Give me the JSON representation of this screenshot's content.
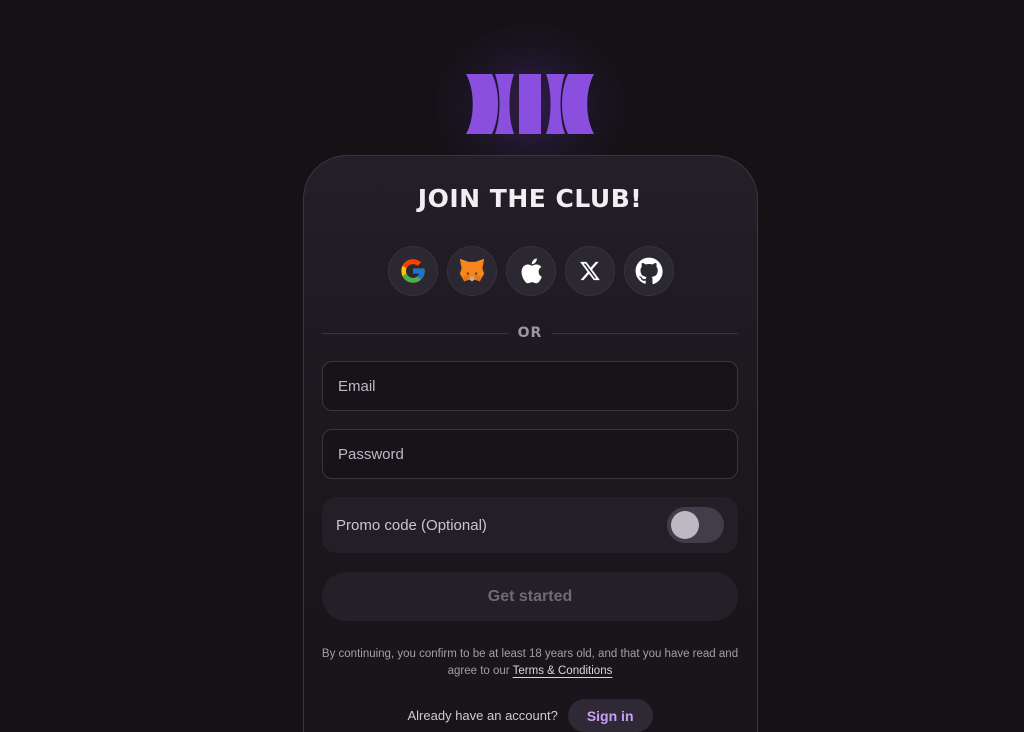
{
  "header": {
    "title": "JOIN THE CLUB!"
  },
  "social_logins": [
    {
      "name": "google",
      "icon": "google-icon"
    },
    {
      "name": "metamask",
      "icon": "metamask-fox-icon"
    },
    {
      "name": "apple",
      "icon": "apple-icon"
    },
    {
      "name": "x",
      "icon": "x-icon"
    },
    {
      "name": "github",
      "icon": "github-icon"
    }
  ],
  "divider": {
    "label": "OR"
  },
  "form": {
    "email_placeholder": "Email",
    "password_placeholder": "Password",
    "promo_label": "Promo code (Optional)",
    "promo_enabled": false,
    "submit_label": "Get started"
  },
  "legal": {
    "text": "By continuing, you confirm to be at least 18 years old, and that you have read and agree to our",
    "link": "Terms & Conditions"
  },
  "signin": {
    "prompt": "Already have an account?",
    "button": "Sign in"
  },
  "colors": {
    "background": "#141215",
    "accent": "#8b4fe0",
    "signin_text": "#c9a0f5"
  }
}
